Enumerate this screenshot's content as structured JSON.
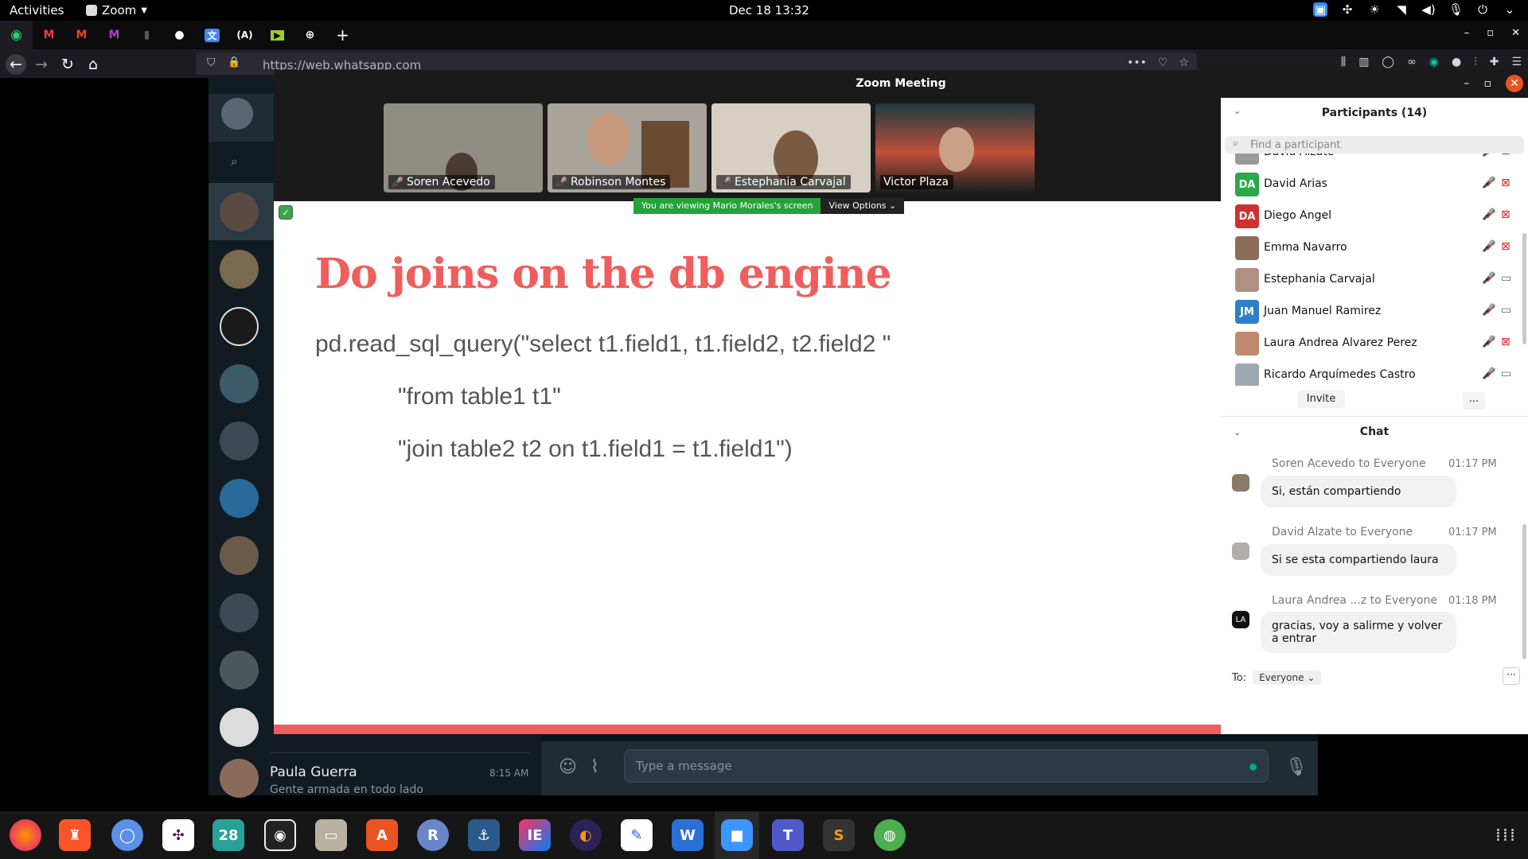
{
  "topbar": {
    "activities": "Activities",
    "app_name": "Zoom",
    "clock": "Dec 18  13:32"
  },
  "browser": {
    "url": "https://web.whatsapp.com"
  },
  "whatsapp": {
    "last_chat": {
      "name": "Paula Guerra",
      "time": "8:15 AM",
      "message": "Gente armada en todo lado"
    },
    "composer_placeholder": "Type a message"
  },
  "zoom": {
    "window_title": "Zoom Meeting",
    "video_tiles": [
      {
        "name": "Soren Acevedo",
        "muted": true
      },
      {
        "name": "Robinson Montes",
        "muted": true
      },
      {
        "name": "Estephania Carvajal",
        "muted": true
      },
      {
        "name": "Victor Plaza",
        "muted": false
      }
    ],
    "viewing_banner": "You are viewing Mario Morales's screen",
    "view_options": "View Options",
    "slide": {
      "title": "Do joins on the db engine",
      "lines": [
        "pd.read_sql_query(\"select t1.field1, t1.field2, t2.field2 \"",
        "\"from table1 t1\"",
        "\"join table2 t2 on t1.field1 = t1.field1\")"
      ]
    },
    "participants": {
      "header": "Participants (14)",
      "search_placeholder": "Find a participant",
      "list": [
        {
          "name": "David Alzate",
          "initials": "",
          "color": "#9a9a9a",
          "cam_on": false
        },
        {
          "name": "David Arias",
          "initials": "DA",
          "color": "#2aa84a",
          "cam_on": false
        },
        {
          "name": "Diego Angel",
          "initials": "DA",
          "color": "#d0302e",
          "cam_on": false
        },
        {
          "name": "Emma Navarro",
          "initials": "",
          "color": "#8a6e5a",
          "cam_on": false
        },
        {
          "name": "Estephania Carvajal",
          "initials": "",
          "color": "#b09080",
          "cam_on": true
        },
        {
          "name": "Juan Manuel Ramirez",
          "initials": "JM",
          "color": "#2f7fc8",
          "cam_on": true
        },
        {
          "name": "Laura Andrea Alvarez Perez",
          "initials": "",
          "color": "#c08a70",
          "cam_on": false
        },
        {
          "name": "Ricardo Arquímedes Castro",
          "initials": "",
          "color": "#a0a8b0",
          "cam_on": true
        }
      ],
      "invite": "Invite",
      "more": "..."
    },
    "chat": {
      "header": "Chat",
      "messages": [
        {
          "from": "Soren Acevedo to Everyone",
          "time": "01:17 PM",
          "text": "Si, están compartiendo",
          "avatar": ""
        },
        {
          "from": "David Alzate to Everyone",
          "time": "01:17 PM",
          "text": "Si se esta compartiendo laura",
          "avatar": ""
        },
        {
          "from": "Laura Andrea ...z to Everyone",
          "time": "01:18 PM",
          "text": "gracias, voy a salirme y volver a entrar",
          "avatar": "LA"
        }
      ],
      "to_label": "To:",
      "to_value": "Everyone"
    }
  },
  "dock": {
    "calendar_day": "28",
    "apps": [
      "firefox-icon",
      "brave-icon",
      "chromium-icon",
      "slack-icon",
      "calendar-icon",
      "screenshot-icon",
      "files-icon",
      "app-center-icon",
      "r-icon",
      "mysql-workbench-icon",
      "intellij-icon",
      "eclipse-icon",
      "notes-icon",
      "word-icon",
      "zoom-icon",
      "teams-icon",
      "sublime-icon",
      "globe-icon"
    ]
  }
}
